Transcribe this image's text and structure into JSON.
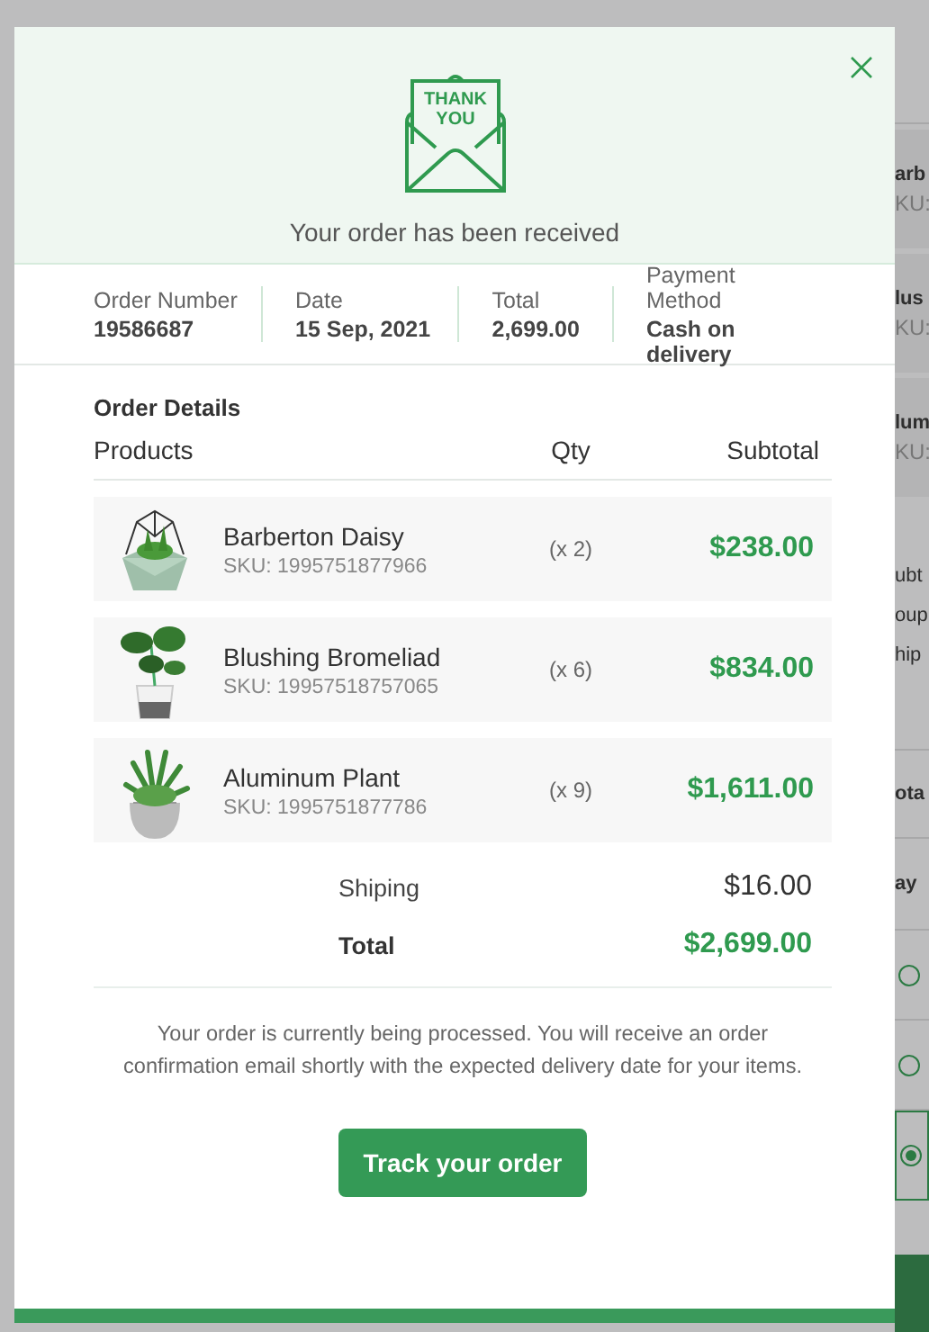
{
  "background_page": {
    "cart_items": [
      {
        "name": "arb",
        "sku": "KU:"
      },
      {
        "name": "lus",
        "sku": "KU:"
      },
      {
        "name": "lum",
        "sku": "KU:"
      }
    ],
    "summary_labels": [
      "ubt",
      "oup",
      "hip"
    ],
    "total_label": "ota",
    "payment_heading": "ay",
    "payment_options": [
      {
        "selected": false
      },
      {
        "selected": false
      },
      {
        "selected": true
      }
    ]
  },
  "dialog": {
    "card_text": [
      "THANK",
      "YOU"
    ],
    "message": "Your order has been received",
    "info": [
      {
        "label": "Order Number",
        "value": "19586687"
      },
      {
        "label": "Date",
        "value": "15 Sep, 2021"
      },
      {
        "label": "Total",
        "value": "2,699.00"
      },
      {
        "label": "Payment Method",
        "value": "Cash on delivery"
      }
    ],
    "details_title": "Order Details",
    "columns": [
      "Products",
      "Qty",
      "Subtotal"
    ],
    "products": [
      {
        "name": "Barberton Daisy",
        "sku": "SKU: 1995751877966",
        "qty": "(x 2)",
        "subtotal": "$238.00"
      },
      {
        "name": "Blushing Bromeliad",
        "sku": "SKU: 19957518757065",
        "qty": "(x 6)",
        "subtotal": "$834.00"
      },
      {
        "name": "Aluminum Plant",
        "sku": "SKU: 1995751877786",
        "qty": "(x 9)",
        "subtotal": "$1,611.00"
      }
    ],
    "totals": [
      {
        "kind": "plain",
        "label": "Shiping",
        "value": "$16.00"
      },
      {
        "kind": "grand",
        "label": "Total",
        "value": "$2,699.00"
      }
    ],
    "note": "Your order is currently being processed. You will receive an order confirmation email shortly with the expected delivery date for your items.",
    "button": "Track your order"
  }
}
